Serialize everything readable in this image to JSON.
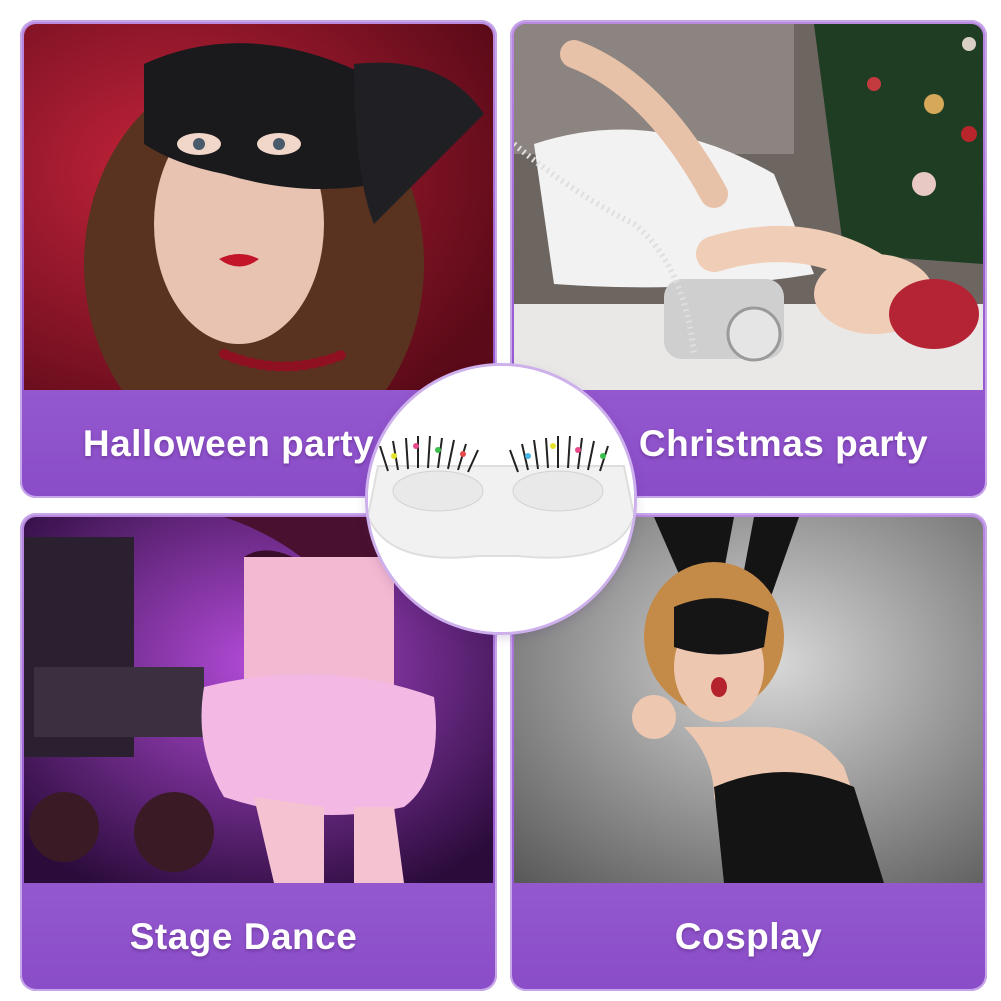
{
  "cards": [
    {
      "label": "Halloween party",
      "image": "woman-black-feather-mask-photo"
    },
    {
      "label": "Christmas party",
      "image": "woman-retro-telephone-christmas-tree-photo"
    },
    {
      "label": "Stage Dance",
      "image": "dancer-pink-feather-skirt-dj-booth-photo"
    },
    {
      "label": "Cosplay",
      "image": "woman-black-bunny-mask-photo"
    }
  ],
  "center": {
    "image": "colorful-false-eyelashes-on-white-display-stand"
  },
  "colors": {
    "label_band": "#9b5fd2",
    "label_text": "#ffffff",
    "card_border": "#c7a6ea"
  }
}
